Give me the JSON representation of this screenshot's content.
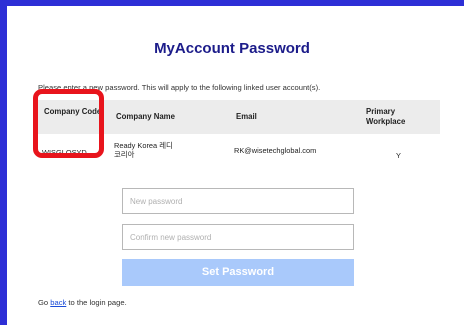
{
  "page": {
    "title": "MyAccount Password",
    "intro": "Please enter a new password. This will apply to the following linked user account(s)."
  },
  "table": {
    "headers": {
      "company_code": "Company Code",
      "company_name": "Company Name",
      "email": "Email",
      "primary_workplace": "Primary Workplace"
    },
    "rows": [
      {
        "company_code": "WISGLOSYD",
        "company_name": "Ready Korea 레디코리아",
        "email": "RK@wisetechglobal.com",
        "primary_workplace": "Y"
      }
    ]
  },
  "form": {
    "new_password_placeholder": "New password",
    "confirm_password_placeholder": "Confirm new password",
    "submit_label": "Set Password"
  },
  "footer": {
    "prefix": "Go ",
    "link": "back",
    "suffix": " to the login page."
  },
  "colors": {
    "frame": "#2d2fd6",
    "title": "#1c1c8a",
    "button": "#a9c9fb",
    "highlight": "#e8141c"
  }
}
